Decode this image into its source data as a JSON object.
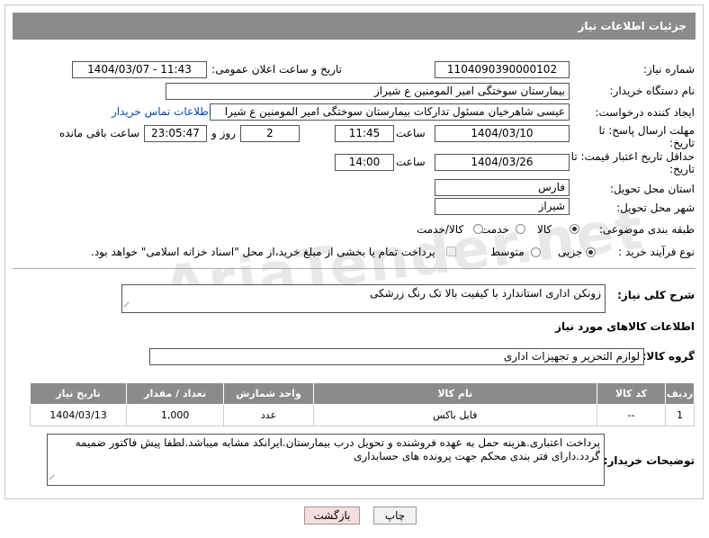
{
  "window": {
    "title": "جزئیات اطلاعات نیاز"
  },
  "form": {
    "need_number_label": "شماره نیاز:",
    "need_number": "1104090390000102",
    "announce_label": "تاریخ و ساعت اعلان عمومی:",
    "announce_value": "1404/03/07 - 11:43",
    "buyer_org_label": "نام دستگاه خریدار:",
    "buyer_org": "بیمارستان سوختگی امیر المومنین  ع  شیراز",
    "creator_label": "ایجاد کننده درخواست:",
    "creator": "عیسی  شاهرخیان مسئول تدارکات بیمارستان سوختگی امیر المومنین  ع  شیرا",
    "contact_link": "اطلاعات تماس خریدار",
    "reply_deadline_label": "مهلت ارسال پاسخ: تا تاریخ:",
    "reply_date": "1404/03/10",
    "time_label": "ساعت",
    "reply_time": "11:45",
    "days_value": "2",
    "days_label": "روز و",
    "remaining_time": "23:05:47",
    "remaining_label": "ساعت باقی مانده",
    "price_validity_label": "حداقل تاریخ اعتبار قیمت: تا تاریخ:",
    "price_date": "1404/03/26",
    "price_time": "14:00",
    "province_label": "استان محل تحویل:",
    "province": "فارس",
    "city_label": "شهر محل تحویل:",
    "city": "شیراز",
    "category_label": "طبقه بندی موضوعی:",
    "category_options": [
      "کالا",
      "خدمت",
      "کالا/خدمت"
    ],
    "process_label": "نوع فرآیند خرید :",
    "process_options": [
      "جزیی",
      "متوسط"
    ],
    "payment_note": "پرداخت تمام یا بخشی از مبلغ خرید،از محل \"اسناد خزانه اسلامی\" خواهد بود."
  },
  "summary": {
    "label": "شرح کلی نیاز:",
    "text": "زونکن اداری استاندارد با کیفیت بالا تک رنگ زرشکی"
  },
  "goods_section": {
    "title": "اطلاعات کالاهای مورد نیاز",
    "group_label": "گروه کالا:",
    "group_value": "لوازم التحریر و تجهیزات اداری"
  },
  "table": {
    "headers": [
      "ردیف",
      "کد کالا",
      "نام کالا",
      "واحد شمارش",
      "تعداد / مقدار",
      "تاریخ نیاز"
    ],
    "rows": [
      [
        "1",
        "--",
        "فایل باکس",
        "عدد",
        "1,000",
        "1404/03/13"
      ]
    ]
  },
  "buyer_notes": {
    "label": "توضیحات خریدار:",
    "text": "پرداخت اعتباری.هزینه حمل به عهده فروشنده و تحویل درب بیمارستان.ایرانکد مشابه میباشد.لطفا پیش فاکتور ضمیمه گردد.دارای فتر بندی محکم جهت پرونده های حسابداری"
  },
  "buttons": {
    "print": "چاپ",
    "back": "بازگشت"
  },
  "watermark": "AriaTender.net",
  "colors": {
    "header_bg": "#8b8b8b",
    "back_button_bg": "#f7dede",
    "link": "#0645ad"
  }
}
